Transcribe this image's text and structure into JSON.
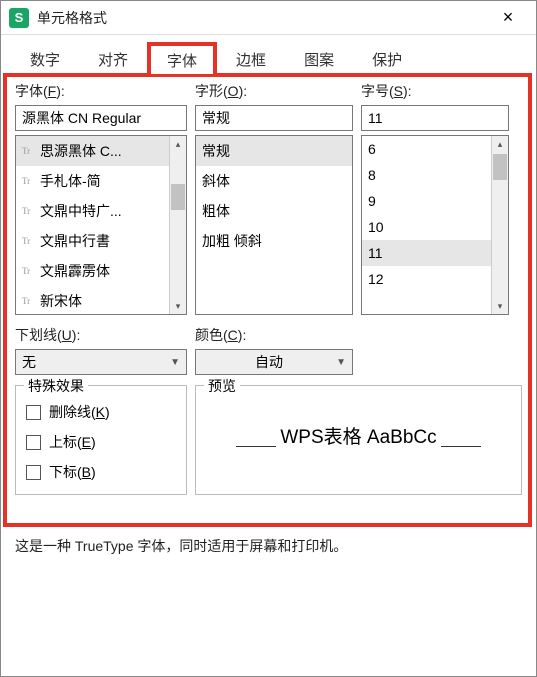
{
  "titlebar": {
    "app_initial": "S",
    "title": "单元格格式",
    "close": "×"
  },
  "tabs": {
    "number": "数字",
    "align": "对齐",
    "font": "字体",
    "border": "边框",
    "pattern": "图案",
    "protect": "保护"
  },
  "labels": {
    "font_pre": "字体(",
    "font_key": "F",
    "font_post": "):",
    "style_pre": "字形(",
    "style_key": "O",
    "style_post": "):",
    "size_pre": "字号(",
    "size_key": "S",
    "size_post": "):",
    "underline_pre": "下划线(",
    "underline_key": "U",
    "underline_post": "):",
    "color_pre": "颜色(",
    "color_key": "C",
    "color_post": "):",
    "fx": "特殊效果",
    "preview": "预览"
  },
  "font": {
    "value": "源黑体 CN Regular",
    "items": [
      "思源黑体 C...",
      "手札体-简",
      "文鼎中特广...",
      "文鼎中行書",
      "文鼎霹雳体",
      "新宋体"
    ]
  },
  "style": {
    "value": "常规",
    "items": [
      "常规",
      "斜体",
      "粗体",
      "加粗 倾斜"
    ]
  },
  "size": {
    "value": "11",
    "items": [
      "6",
      "8",
      "9",
      "10",
      "11",
      "12"
    ]
  },
  "underline": {
    "value": "无"
  },
  "color": {
    "value": "自动"
  },
  "effects": {
    "strike_pre": "删除线(",
    "strike_key": "K",
    "strike_post": ")",
    "super_pre": "上标(",
    "super_key": "E",
    "super_post": ")",
    "sub_pre": "下标(",
    "sub_key": "B",
    "sub_post": ")"
  },
  "preview_text": "WPS表格 AaBbCc",
  "footnote": "这是一种 TrueType 字体，同时适用于屏幕和打印机。"
}
